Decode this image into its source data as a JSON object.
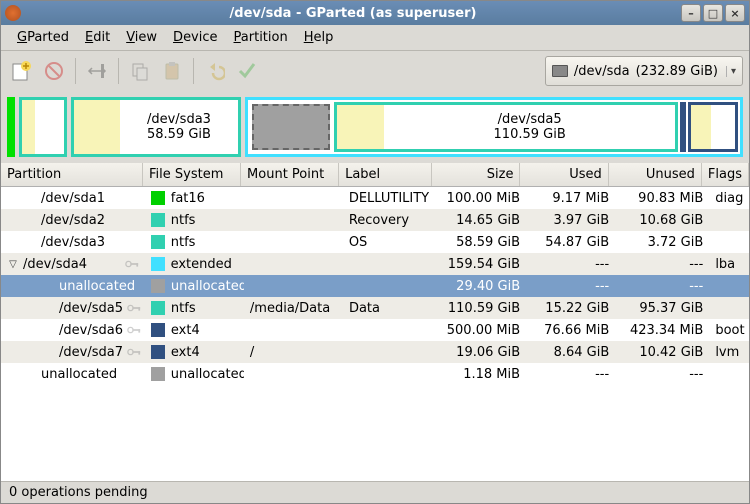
{
  "window": {
    "title": "/dev/sda - GParted (as superuser)"
  },
  "menu": {
    "gparted": "GParted",
    "edit": "Edit",
    "view": "View",
    "device": "Device",
    "partition": "Partition",
    "help": "Help"
  },
  "device_selector": {
    "device": "/dev/sda",
    "size": "(232.89 GiB)"
  },
  "strip": {
    "sda3": {
      "name": "/dev/sda3",
      "size": "58.59 GiB"
    },
    "sda5": {
      "name": "/dev/sda5",
      "size": "110.59 GiB"
    }
  },
  "headers": {
    "partition": "Partition",
    "fs": "File System",
    "mount": "Mount Point",
    "label": "Label",
    "size": "Size",
    "used": "Used",
    "unused": "Unused",
    "flags": "Flags"
  },
  "colors": {
    "fat16": "#00d000",
    "ntfs": "#30d0b0",
    "extended": "#40e0ff",
    "ext4": "#305080",
    "unalloc": "#a0a0a0"
  },
  "rows": [
    {
      "indent": 1,
      "part": "/dev/sda1",
      "key": false,
      "expander": "",
      "fs": "fat16",
      "color": "#00d000",
      "mp": "",
      "label": "DELLUTILITY",
      "size": "100.00 MiB",
      "used": "9.17 MiB",
      "unused": "90.83 MiB",
      "flags": "diag"
    },
    {
      "indent": 1,
      "part": "/dev/sda2",
      "key": false,
      "expander": "",
      "fs": "ntfs",
      "color": "#30d0b0",
      "mp": "",
      "label": "Recovery",
      "size": "14.65 GiB",
      "used": "3.97 GiB",
      "unused": "10.68 GiB",
      "flags": ""
    },
    {
      "indent": 1,
      "part": "/dev/sda3",
      "key": false,
      "expander": "",
      "fs": "ntfs",
      "color": "#30d0b0",
      "mp": "",
      "label": "OS",
      "size": "58.59 GiB",
      "used": "54.87 GiB",
      "unused": "3.72 GiB",
      "flags": ""
    },
    {
      "indent": 0,
      "part": "/dev/sda4",
      "key": true,
      "expander": "▽",
      "fs": "extended",
      "color": "#40e0ff",
      "mp": "",
      "label": "",
      "size": "159.54 GiB",
      "used": "---",
      "unused": "---",
      "flags": "lba"
    },
    {
      "indent": 2,
      "part": "unallocated",
      "key": false,
      "expander": "",
      "fs": "unallocated",
      "color": "#a0a0a0",
      "mp": "",
      "label": "",
      "size": "29.40 GiB",
      "used": "---",
      "unused": "---",
      "flags": "",
      "selected": true
    },
    {
      "indent": 2,
      "part": "/dev/sda5",
      "key": true,
      "expander": "",
      "fs": "ntfs",
      "color": "#30d0b0",
      "mp": "/media/Data",
      "label": "Data",
      "size": "110.59 GiB",
      "used": "15.22 GiB",
      "unused": "95.37 GiB",
      "flags": ""
    },
    {
      "indent": 2,
      "part": "/dev/sda6",
      "key": true,
      "expander": "",
      "fs": "ext4",
      "color": "#305080",
      "mp": "",
      "label": "",
      "size": "500.00 MiB",
      "used": "76.66 MiB",
      "unused": "423.34 MiB",
      "flags": "boot"
    },
    {
      "indent": 2,
      "part": "/dev/sda7",
      "key": true,
      "expander": "",
      "fs": "ext4",
      "color": "#305080",
      "mp": "/",
      "label": "",
      "size": "19.06 GiB",
      "used": "8.64 GiB",
      "unused": "10.42 GiB",
      "flags": "lvm"
    },
    {
      "indent": 1,
      "part": "unallocated",
      "key": false,
      "expander": "",
      "fs": "unallocated",
      "color": "#a0a0a0",
      "mp": "",
      "label": "",
      "size": "1.18 MiB",
      "used": "---",
      "unused": "---",
      "flags": ""
    }
  ],
  "status": "0 operations pending"
}
